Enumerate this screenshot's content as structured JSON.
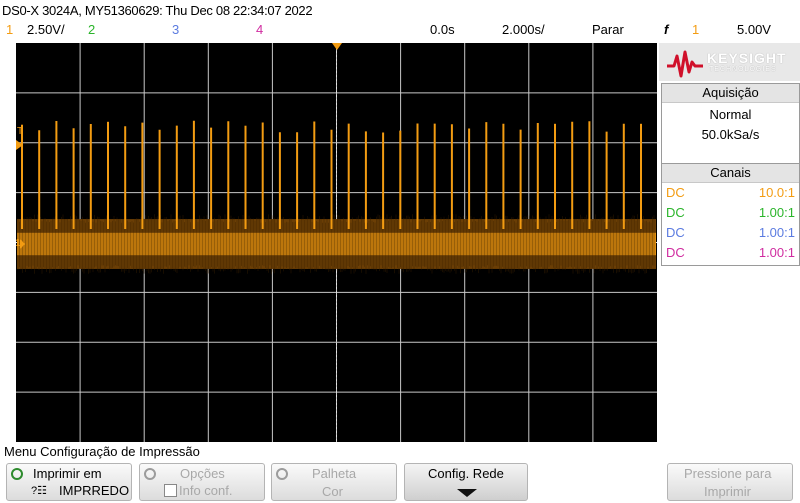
{
  "header": {
    "title": "DS0-X 3024A, MY51360629: Thu Dec 08 22:34:07 2022"
  },
  "status": {
    "ch1_num": "1",
    "ch1_scale": "2.50V/",
    "ch2_num": "2",
    "ch3_num": "3",
    "ch4_num": "4",
    "time_delay": "0.0s",
    "time_scale": "2.000s/",
    "run_state": "Parar",
    "trigger_icon": "f",
    "trigger_source": "1",
    "trigger_level": "5.00V"
  },
  "colors": {
    "ch1": "#f39c12",
    "ch2": "#2bb52b",
    "ch3": "#5b7be0",
    "ch4": "#d02ca0",
    "grid": "#c8c8c8",
    "screen": "#000000"
  },
  "scope": {
    "trigger_marker": "T",
    "ch1_marker": "1",
    "waveform": {
      "channel": "ch1",
      "baseline_v": 0.0,
      "noise_band_v": 2.5,
      "spike_count": 37,
      "spike_peak_v": 6.0
    }
  },
  "panel": {
    "brand": "KEYSIGHT",
    "brand_sub": "TECHNOLOGIES",
    "acq_title": "Aquisição",
    "acq_mode": "Normal",
    "acq_rate": "50.0kSa/s",
    "channels_title": "Canais",
    "channels": [
      {
        "coupling": "DC",
        "probe": "10.0:1"
      },
      {
        "coupling": "DC",
        "probe": "1.00:1"
      },
      {
        "coupling": "DC",
        "probe": "1.00:1"
      },
      {
        "coupling": "DC",
        "probe": "1.00:1"
      }
    ]
  },
  "menu": {
    "title": "Menu Configuração de Impressão",
    "print_to_label": "Imprimir em",
    "print_to_value": "IMPRREDO",
    "options_label": "Opções",
    "options_value": "Info conf.",
    "palette_label": "Palheta",
    "palette_value": "Cor",
    "network_label": "Config. Rede",
    "press_to_print_1": "Pressione para",
    "press_to_print_2": "Imprimir"
  }
}
